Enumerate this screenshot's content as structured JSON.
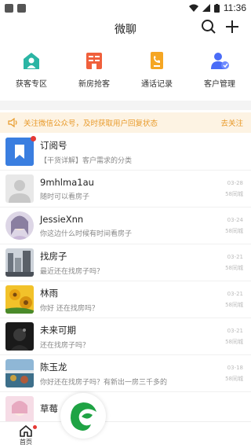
{
  "status_bar": {
    "time": "11:36"
  },
  "header": {
    "title": "微聊"
  },
  "quick_actions": [
    {
      "label": "获客专区",
      "icon": "house-user-icon",
      "color": "#2bb5a4"
    },
    {
      "label": "新房抢客",
      "icon": "building-icon",
      "color": "#f0603c"
    },
    {
      "label": "通话记录",
      "icon": "phone-record-icon",
      "color": "#f5a623"
    },
    {
      "label": "客户管理",
      "icon": "user-manage-icon",
      "color": "#4a6cf7"
    }
  ],
  "notice": {
    "text": "关注微信公众号，及时获取用户回复状态",
    "action": "去关注"
  },
  "conversations": [
    {
      "name": "订阅号",
      "preview": "【干货详解】客户需求的分类",
      "date": "",
      "status": ""
    },
    {
      "name": "9mhlma1au",
      "preview": "随时可以看房子",
      "date": "03-28",
      "status": "58同城"
    },
    {
      "name": "JessieXnn",
      "preview": "你这边什么时候有时间看房子",
      "date": "03-24",
      "status": "58同城"
    },
    {
      "name": "找房子",
      "preview": "最近还在找房子吗？",
      "date": "03-21",
      "status": "58同城"
    },
    {
      "name": "林雨",
      "preview": "你好 还在找房吗？",
      "date": "03-21",
      "status": "58同城"
    },
    {
      "name": "未来可期",
      "preview": "还在找房子吗？",
      "date": "03-21",
      "status": "58同城"
    },
    {
      "name": "陈玉龙",
      "preview": "你好还在找房子吗？有新出一房三千多的",
      "date": "03-18",
      "status": "58同城"
    },
    {
      "name": "草莓",
      "preview": "",
      "date": "",
      "status": ""
    }
  ],
  "tabbar": {
    "home_label": "首页"
  },
  "colors": {
    "accent_orange": "#e89a2a",
    "notice_bg": "#fdf3e3",
    "logo_green": "#1fa344"
  }
}
